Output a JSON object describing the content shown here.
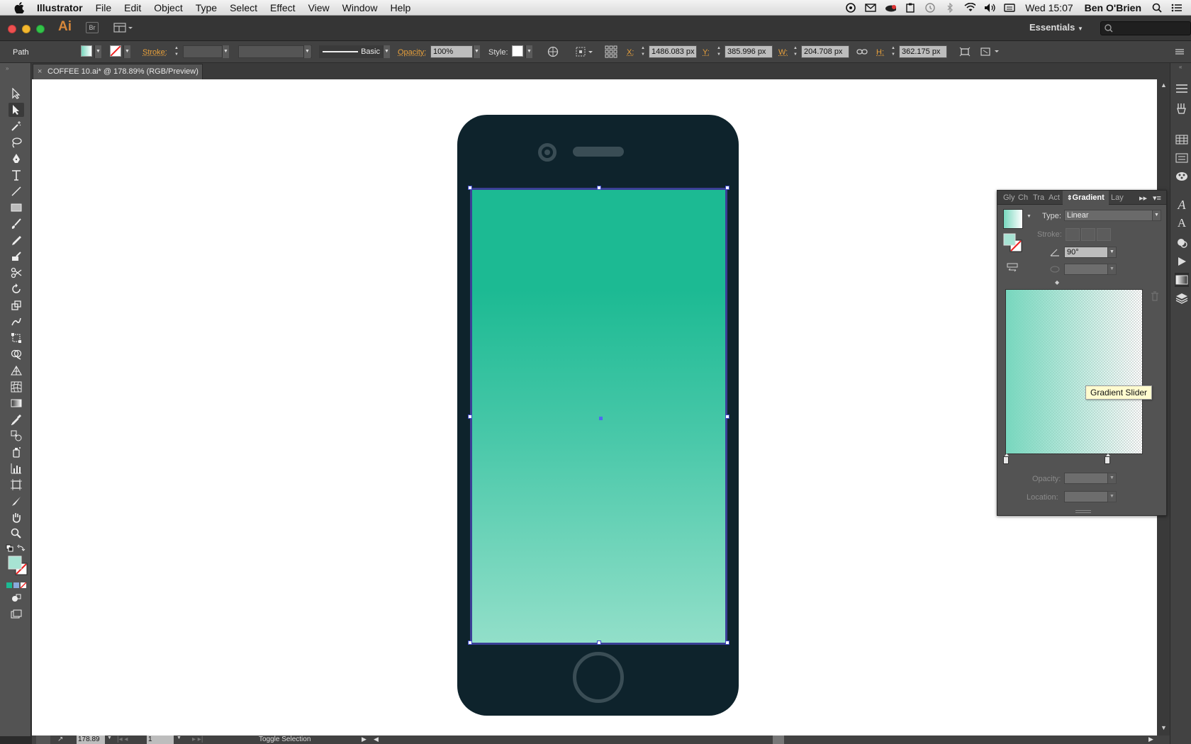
{
  "menubar": {
    "app_name": "Illustrator",
    "items": [
      "File",
      "Edit",
      "Object",
      "Type",
      "Select",
      "Effect",
      "View",
      "Window",
      "Help"
    ],
    "clock": "Wed 15:07",
    "user": "Ben O'Brien"
  },
  "appbar": {
    "logo": "Ai",
    "bridge_label": "Br",
    "workspace": "Essentials"
  },
  "control": {
    "selection_type": "Path",
    "stroke_label": "Stroke:",
    "brush_label": "Basic",
    "opacity_label": "Opacity:",
    "opacity_value": "100%",
    "style_label": "Style:",
    "x_label": "X:",
    "x_value": "1486.083 px",
    "y_label": "Y:",
    "y_value": "385.996 px",
    "w_label": "W:",
    "w_value": "204.708 px",
    "h_label": "H:",
    "h_value": "362.175 px"
  },
  "document": {
    "tab_title": "COFFEE 10.ai* @ 178.89% (RGB/Preview)"
  },
  "statusbar": {
    "zoom": "178.89",
    "artboard": "1",
    "status_text": "Toggle Selection"
  },
  "gradient_panel": {
    "tabs": [
      "Gly",
      "Ch",
      "Tra",
      "Act",
      "Gradient",
      "Lay"
    ],
    "type_label": "Type:",
    "type_value": "Linear",
    "stroke_label": "Stroke:",
    "angle_value": "90°",
    "opacity_label": "Opacity:",
    "location_label": "Location:",
    "tooltip": "Gradient Slider",
    "gradient_color": "#78d7be"
  },
  "colors": {
    "phone_body": "#0e232c",
    "screen_top": "#1cba93",
    "screen_bottom": "#92dfc9",
    "selection": "#3b46c5"
  }
}
